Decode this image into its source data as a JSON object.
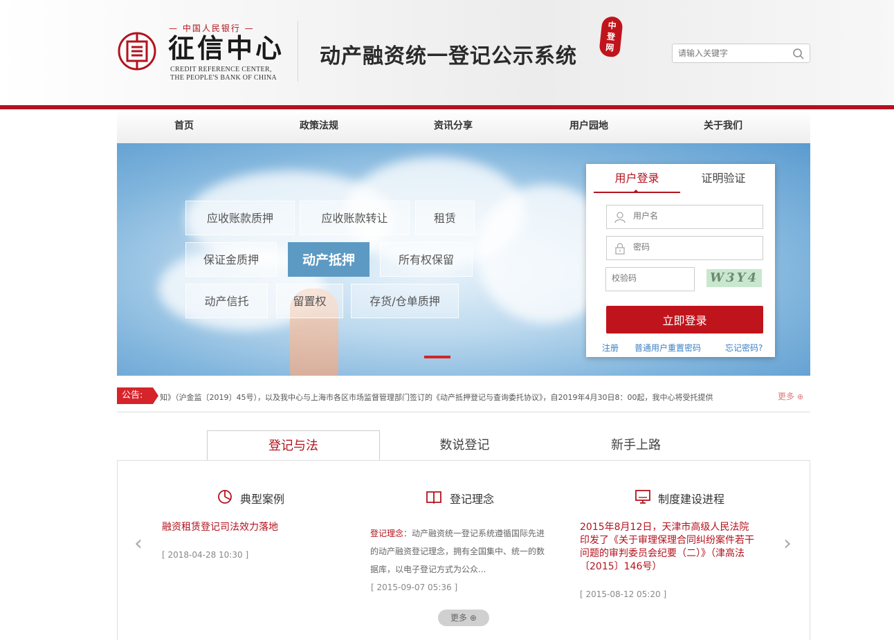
{
  "header": {
    "logo_top": "中国人民银行",
    "logo_main": "征信中心",
    "logo_en_line1": "CREDIT REFERENCE CENTER,",
    "logo_en_line2": "THE PEOPLE'S BANK OF CHINA",
    "system_title": "动产融资统一登记公示系统",
    "badge_chars": [
      "中",
      "登",
      "网"
    ],
    "search_placeholder": "请输入关键字"
  },
  "nav": {
    "items": [
      "首页",
      "政策法规",
      "资讯分享",
      "用户园地",
      "关于我们"
    ]
  },
  "banner": {
    "tags": [
      "应收账款质押",
      "应收账款转让",
      "租赁",
      "保证金质押",
      "动产抵押",
      "所有权保留",
      "动产信托",
      "留置权",
      "存货/仓单质押"
    ],
    "active_tag": "动产抵押"
  },
  "login": {
    "tab_login": "用户登录",
    "tab_verify": "证明验证",
    "username_placeholder": "用户名",
    "password_placeholder": "密码",
    "captcha_placeholder": "校验码",
    "captcha_text": "W3Y4",
    "submit_label": "立即登录",
    "register": "注册",
    "reset_password": "普通用户重置密码",
    "forgot_password": "忘记密码?"
  },
  "notice": {
    "label": "公告:",
    "text": "知》（沪金监〔2019〕45号），以及我中心与上海市各区市场监督管理部门签订的《动产抵押登记与查询委托协议》，自2019年4月30日8：00起，我中心将受托提供",
    "more": "更多"
  },
  "tabs": [
    "登记与法",
    "数说登记",
    "新手上路"
  ],
  "columns": {
    "col1": {
      "title": "典型案例",
      "link": "融资租赁登记司法效力落地",
      "date": "[ 2018-04-28 10:30 ]"
    },
    "col2": {
      "title": "登记理念",
      "highlight": "登记理念",
      "desc": "：动产融资统一登记系统遵循国际先进的动产融资登记理念，拥有全国集中、统一的数据库，以电子登记方式为公众...",
      "date": "[ 2015-09-07 05:36 ]"
    },
    "col3": {
      "title": "制度建设进程",
      "link": "2015年8月12日，天津市高级人民法院印发了《关于审理保理合同纠纷案件若干问题的审判委员会纪要（二）》（津高法〔2015〕146号）",
      "date": "[ 2015-08-12 05:20 ]"
    }
  },
  "more_label": "更多",
  "colors": {
    "brand_red": "#b3121d",
    "button_red": "#c0141c",
    "link_blue": "#3a7fc1"
  }
}
